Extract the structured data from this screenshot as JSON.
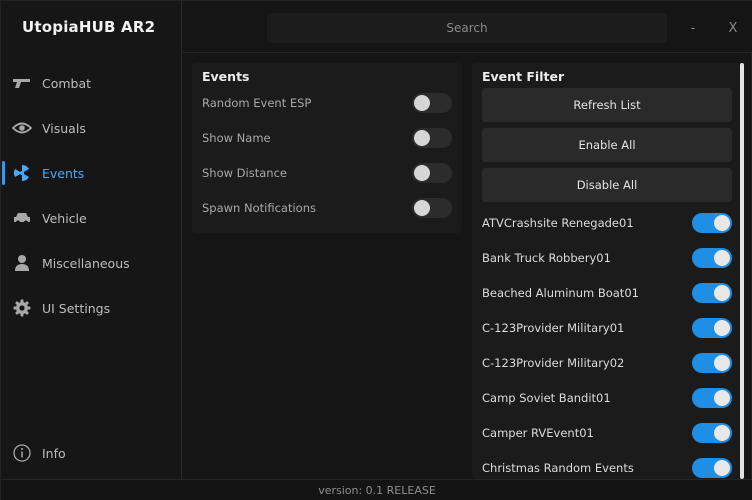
{
  "app": {
    "title": "UtopiaHUB AR2"
  },
  "search": {
    "placeholder": "Search"
  },
  "window_controls": {
    "minimize": "-",
    "close": "X"
  },
  "sidebar": {
    "items": [
      {
        "label": "Combat",
        "icon": "gun-icon",
        "active": false
      },
      {
        "label": "Visuals",
        "icon": "eye-icon",
        "active": false
      },
      {
        "label": "Events",
        "icon": "radiation-icon",
        "active": true
      },
      {
        "label": "Vehicle",
        "icon": "car-icon",
        "active": false
      },
      {
        "label": "Miscellaneous",
        "icon": "user-icon",
        "active": false
      },
      {
        "label": "UI Settings",
        "icon": "gear-icon",
        "active": false
      }
    ],
    "info": {
      "label": "Info",
      "icon": "info-icon"
    }
  },
  "events_panel": {
    "title": "Events",
    "options": [
      {
        "label": "Random Event ESP",
        "enabled": false
      },
      {
        "label": "Show Name",
        "enabled": false
      },
      {
        "label": "Show Distance",
        "enabled": false
      },
      {
        "label": "Spawn Notifications",
        "enabled": false
      }
    ]
  },
  "filter_panel": {
    "title": "Event Filter",
    "buttons": {
      "refresh": "Refresh List",
      "enable_all": "Enable All",
      "disable_all": "Disable All"
    },
    "items": [
      {
        "label": "ATVCrashsite Renegade01",
        "enabled": true
      },
      {
        "label": "Bank Truck Robbery01",
        "enabled": true
      },
      {
        "label": "Beached Aluminum Boat01",
        "enabled": true
      },
      {
        "label": "C-123Provider Military01",
        "enabled": true
      },
      {
        "label": "C-123Provider Military02",
        "enabled": true
      },
      {
        "label": "Camp Soviet Bandit01",
        "enabled": true
      },
      {
        "label": "Camper RVEvent01",
        "enabled": true
      },
      {
        "label": "Christmas Random Events",
        "enabled": true
      }
    ]
  },
  "footer": {
    "version": "version: 0.1 RELEASE"
  },
  "colors": {
    "accent": "#2f9bff",
    "toggle_on": "#1f8fe6",
    "background": "#151515",
    "panel": "#1b1b1b"
  }
}
